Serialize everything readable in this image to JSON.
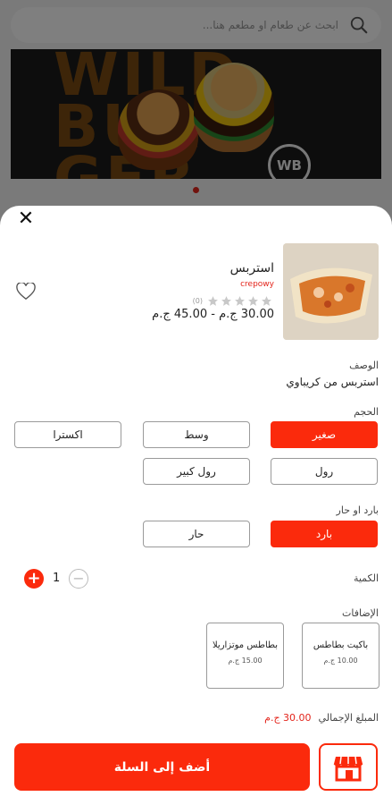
{
  "search": {
    "placeholder": "ابحث عن طعام او مطعم هنا..."
  },
  "banner": {
    "text_line1": "WILD",
    "text_line2": "BUR",
    "text_line3": "GER",
    "logo_text": "WB"
  },
  "product": {
    "name": "استربس",
    "brand": "crepowy",
    "rating_count": "(0)",
    "rating_stars": 0,
    "price_range": "30.00 ج.م - 45.00 ج.م"
  },
  "description": {
    "label": "الوصف",
    "text": "استربس من كريباوي"
  },
  "size": {
    "label": "الحجم",
    "options": [
      "صغير",
      "وسط",
      "اكسترا",
      "رول",
      "رول كبير"
    ],
    "selected": "صغير"
  },
  "temperature": {
    "label": "بارد او حار",
    "options": [
      "بارد",
      "حار"
    ],
    "selected": "بارد"
  },
  "quantity": {
    "label": "الكمية",
    "value": "1",
    "plus": "+",
    "minus": "−"
  },
  "addons": {
    "label": "الإضافات",
    "items": [
      {
        "name": "باكيت بطاطس",
        "price": "10.00 ج.م"
      },
      {
        "name": "بطاطس موتزاريلا",
        "price": "15.00 ج.م"
      }
    ]
  },
  "total": {
    "label": "المبلغ الإجمالي",
    "value": "30.00 ج.م"
  },
  "actions": {
    "add_to_cart": "أضف إلى السلة",
    "close": "✕"
  },
  "colors": {
    "accent": "#fb2a0c",
    "brand_red": "#e3241b"
  }
}
